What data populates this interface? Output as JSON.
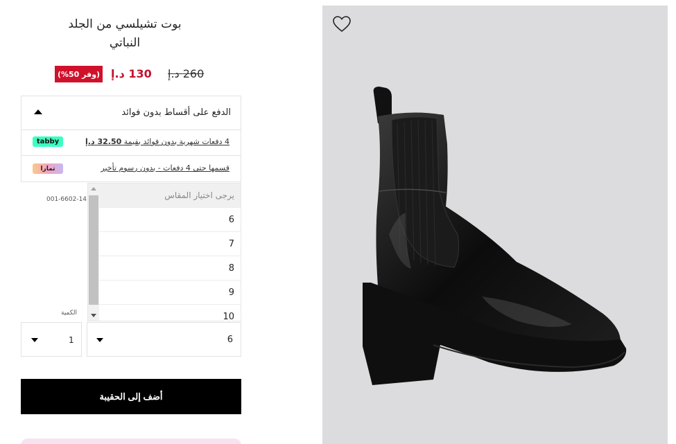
{
  "product": {
    "title_line1": "بوت تشيلسي من الجلد",
    "title_line2": "النباتي",
    "old_price": "260 د.إ",
    "new_price": "130 د.إ",
    "discount_badge": "(وفر 50%)",
    "sku": "001-6602-14"
  },
  "installments": {
    "header": "الدفع على أقساط بدون فوائد",
    "header_icon": "triangle-up-icon",
    "tabby": {
      "text_prefix": "4 دفعات شهرية بدون فوائد بقيمة",
      "amount": "32.50 د.إ",
      "logo": "tabby"
    },
    "tamara": {
      "text": "قسمها حتى 4 دفعات - بدون رسوم تأخير",
      "logo": "تمارا"
    }
  },
  "size_dropdown": {
    "placeholder": "يرجى اختيار المقاس",
    "options": [
      "6",
      "7",
      "8",
      "9",
      "10"
    ],
    "selected": "6"
  },
  "quantity": {
    "label": "الكمية",
    "value": "1"
  },
  "add_to_bag": "أضف إلى الحقيبة",
  "icons": {
    "favorite": "heart-outline-icon",
    "dropdown": "triangle-down-icon"
  },
  "colors": {
    "sale_red": "#c4122f",
    "badge_red": "#d0112b",
    "tabby_green": "#3bffc0",
    "button_black": "#000000",
    "image_bg": "#dcdbdd"
  }
}
